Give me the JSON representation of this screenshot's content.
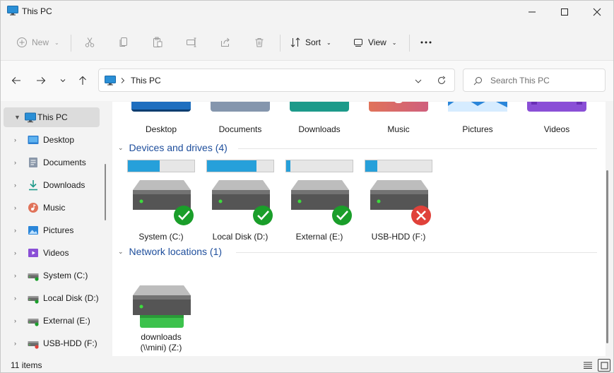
{
  "window": {
    "title": "This PC",
    "minimize": "minimize",
    "maximize": "maximize",
    "close": "close"
  },
  "toolbar": {
    "new_label": "New",
    "sort_label": "Sort",
    "view_label": "View"
  },
  "address": {
    "location": "This PC",
    "search_placeholder": "Search This PC"
  },
  "sidebar": {
    "items": [
      {
        "label": "This PC",
        "icon": "pc-icon",
        "selected": true
      },
      {
        "label": "Desktop",
        "icon": "desktop-icon"
      },
      {
        "label": "Documents",
        "icon": "documents-icon"
      },
      {
        "label": "Downloads",
        "icon": "downloads-icon"
      },
      {
        "label": "Music",
        "icon": "music-icon"
      },
      {
        "label": "Pictures",
        "icon": "pictures-icon"
      },
      {
        "label": "Videos",
        "icon": "videos-icon"
      },
      {
        "label": "System (C:)",
        "icon": "drive-icon"
      },
      {
        "label": "Local Disk (D:)",
        "icon": "drive-icon"
      },
      {
        "label": "External (E:)",
        "icon": "drive-icon"
      },
      {
        "label": "USB-HDD (F:)",
        "icon": "drive-icon"
      }
    ]
  },
  "folders": [
    {
      "label": "Desktop",
      "color": "#1f6fbf"
    },
    {
      "label": "Documents",
      "color": "#8596ad"
    },
    {
      "label": "Downloads",
      "color": "#1d9a8a"
    },
    {
      "label": "Music",
      "color": "#e0735a"
    },
    {
      "label": "Pictures",
      "color": "#2b86d9"
    },
    {
      "label": "Videos",
      "color": "#8a4fd6"
    }
  ],
  "sections": {
    "devices": "Devices and drives (4)",
    "network": "Network locations (1)"
  },
  "drives": [
    {
      "label": "System (C:)",
      "used_fraction": 0.48,
      "status": "ok"
    },
    {
      "label": "Local Disk (D:)",
      "used_fraction": 0.74,
      "status": "ok"
    },
    {
      "label": "External (E:)",
      "used_fraction": 0.06,
      "status": "ok"
    },
    {
      "label": "USB-HDD (F:)",
      "used_fraction": 0.18,
      "status": "error"
    }
  ],
  "network": [
    {
      "label_line1": "downloads",
      "label_line2": "(\\\\mini) (Z:)"
    }
  ],
  "status": {
    "items": "11 items"
  },
  "colors": {
    "accent": "#26a0da",
    "section": "#1e4e9c",
    "ok": "#1a9e2a",
    "error": "#e0413a"
  }
}
